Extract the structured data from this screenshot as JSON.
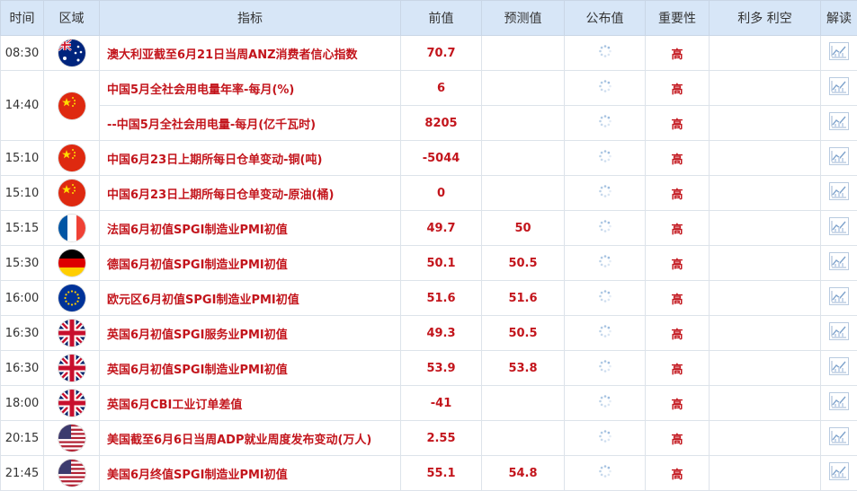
{
  "header": {
    "time": "时间",
    "region": "区域",
    "indicator": "指标",
    "previous": "前值",
    "forecast": "预测值",
    "actual": "公布值",
    "importance": "重要性",
    "impact": "利多 利空",
    "analysis": "解读"
  },
  "rows": [
    {
      "time": "08:30",
      "flag": "australia-flag",
      "indicator": "澳大利亚截至6月21日当周ANZ消费者信心指数",
      "previous": "70.7",
      "forecast": "",
      "importance": "高"
    },
    {
      "time": "14:40",
      "flag": "china-flag",
      "indicator": "中国5月全社会用电量年率-每月(%)",
      "previous": "6",
      "forecast": "",
      "importance": "高"
    },
    {
      "time": "",
      "flag": "",
      "indicator": "--中国5月全社会用电量-每月(亿千瓦时)",
      "previous": "8205",
      "forecast": "",
      "importance": "高"
    },
    {
      "time": "15:10",
      "flag": "china-flag",
      "indicator": "中国6月23日上期所每日仓单变动-铜(吨)",
      "previous": "-5044",
      "forecast": "",
      "importance": "高"
    },
    {
      "time": "15:10",
      "flag": "china-flag",
      "indicator": "中国6月23日上期所每日仓单变动-原油(桶)",
      "previous": "0",
      "forecast": "",
      "importance": "高"
    },
    {
      "time": "15:15",
      "flag": "france-flag",
      "indicator": "法国6月初值SPGI制造业PMI初值",
      "previous": "49.7",
      "forecast": "50",
      "importance": "高"
    },
    {
      "time": "15:30",
      "flag": "germany-flag",
      "indicator": "德国6月初值SPGI制造业PMI初值",
      "previous": "50.1",
      "forecast": "50.5",
      "importance": "高"
    },
    {
      "time": "16:00",
      "flag": "eu-flag",
      "indicator": "欧元区6月初值SPGI制造业PMI初值",
      "previous": "51.6",
      "forecast": "51.6",
      "importance": "高"
    },
    {
      "time": "16:30",
      "flag": "uk-flag",
      "indicator": "英国6月初值SPGI服务业PMI初值",
      "previous": "49.3",
      "forecast": "50.5",
      "importance": "高"
    },
    {
      "time": "16:30",
      "flag": "uk-flag",
      "indicator": "英国6月初值SPGI制造业PMI初值",
      "previous": "53.9",
      "forecast": "53.8",
      "importance": "高"
    },
    {
      "time": "18:00",
      "flag": "uk-flag",
      "indicator": "英国6月CBI工业订单差值",
      "previous": "-41",
      "forecast": "",
      "importance": "高"
    },
    {
      "time": "20:15",
      "flag": "usa-flag",
      "indicator": "美国截至6月6日当周ADP就业周度发布变动(万人)",
      "previous": "2.55",
      "forecast": "",
      "importance": "高"
    },
    {
      "time": "21:45",
      "flag": "usa-flag",
      "indicator": "美国6月终值SPGI制造业PMI初值",
      "previous": "55.1",
      "forecast": "54.8",
      "importance": "高"
    }
  ],
  "colors": {
    "header_bg": "#d7e6f7",
    "accent_red": "#c3151c",
    "border": "#dde3ea"
  },
  "icons": {
    "actual_pending": "loading-spinner-icon",
    "analysis": "chart-icon"
  }
}
